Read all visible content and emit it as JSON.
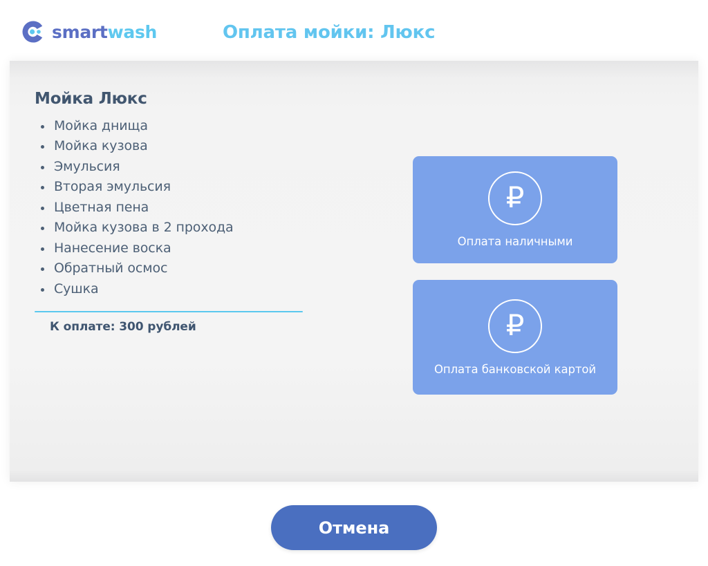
{
  "header": {
    "brand_smart": "smart",
    "brand_wash": "wash",
    "logo_icon": "smartwash-c-dots-logo-icon",
    "title": "Оплата мойки: Люкс"
  },
  "main": {
    "wash_title": "Мойка Люкс",
    "services": [
      "Мойка днища",
      "Мойка кузова",
      "Эмульсия",
      "Вторая эмульсия",
      "Цветная пена",
      "Мойка кузова в 2 прохода",
      "Нанесение воска",
      "Обратный осмос",
      "Сушка"
    ],
    "price_label": "К оплате: 300 рублей",
    "price_value": 300,
    "currency": "рублей"
  },
  "payment": {
    "cash": {
      "label": "Оплата наличными",
      "icon": "ruble-coin-icon",
      "glyph": "₽"
    },
    "card": {
      "label": "Оплата банковской картой",
      "icon": "ruble-coin-icon",
      "glyph": "₽"
    }
  },
  "footer": {
    "cancel_label": "Отмена"
  },
  "colors": {
    "brand_smart": "#5b6fc4",
    "brand_wash": "#5ec8ef",
    "title": "#62c5ef",
    "pay_button": "#7ba2ea",
    "cancel_button": "#4a6fc0",
    "divider": "#5ac8ee",
    "text": "#4d6076",
    "panel_bg": "#f4f4f4"
  }
}
